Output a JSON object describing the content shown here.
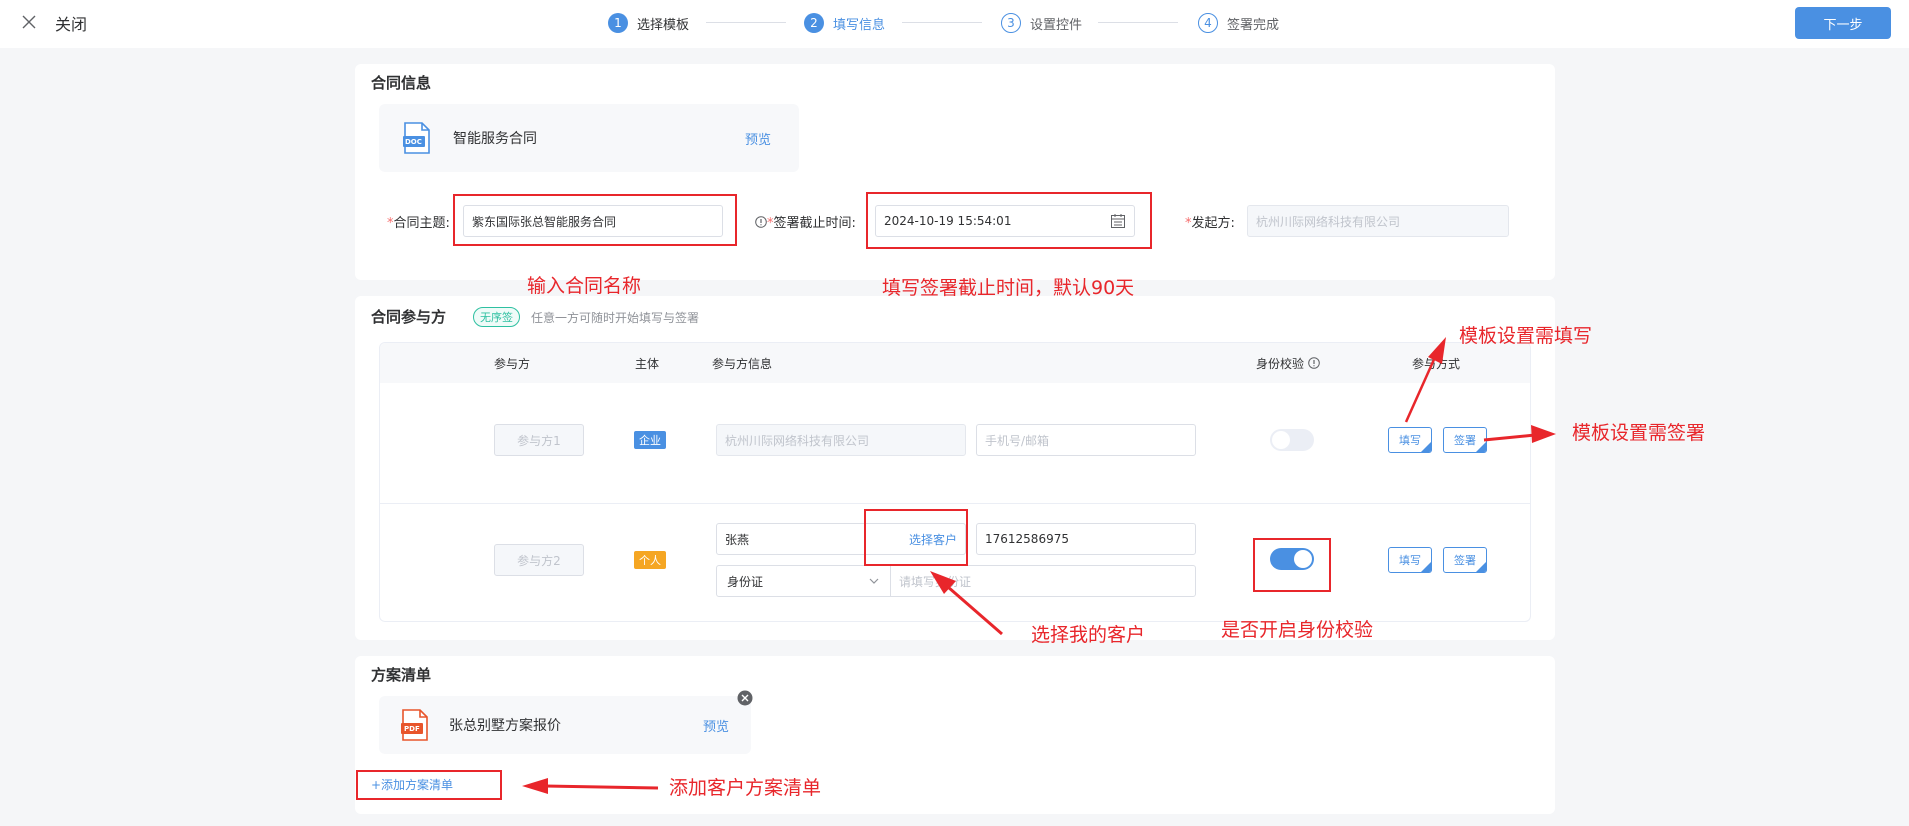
{
  "header": {
    "close_label": "关闭",
    "steps": [
      {
        "num": "1",
        "label": "选择模板",
        "state": "done"
      },
      {
        "num": "2",
        "label": "填写信息",
        "state": "active"
      },
      {
        "num": "3",
        "label": "设置控件",
        "state": "todo"
      },
      {
        "num": "4",
        "label": "签署完成",
        "state": "todo"
      }
    ],
    "next_label": "下一步"
  },
  "contract_info": {
    "title": "合同信息",
    "file": {
      "icon": "doc-file-icon",
      "icon_text": "DOC",
      "name": "智能服务合同",
      "preview": "预览"
    },
    "subject_label": "合同主题:",
    "subject_value": "紫东国际张总智能服务合同",
    "deadline_label": "签署截止时间:",
    "deadline_value": "2024-10-19 15:54:01",
    "initiator_label": "发起方:",
    "initiator_value": "杭州川际网络科技有限公司"
  },
  "parties": {
    "title": "合同参与方",
    "badge": "无序签",
    "hint": "任意一方可随时开始填写与签署",
    "columns": [
      "参与方",
      "主体",
      "参与方信息",
      "身份校验",
      "参与方式"
    ],
    "rows": [
      {
        "name": "参与方1",
        "entity": "企业",
        "entity_color": "#4a90e2",
        "org": "杭州川际网络科技有限公司",
        "contact_placeholder": "手机号/邮箱",
        "id_check": false,
        "fill_label": "填写",
        "sign_label": "签署"
      },
      {
        "name": "参与方2",
        "entity": "个人",
        "entity_color": "#f5a623",
        "person": "张燕",
        "select_customer": "选择客户",
        "phone": "17612586975",
        "id_type": "身份证",
        "id_placeholder": "请填写身份证",
        "id_check": true,
        "fill_label": "填写",
        "sign_label": "签署"
      }
    ]
  },
  "plan": {
    "title": "方案清单",
    "file": {
      "icon": "pdf-file-icon",
      "icon_text": "PDF",
      "name": "张总别墅方案报价",
      "preview": "预览"
    },
    "add_label": "+添加方案清单"
  },
  "annotations": {
    "subject": "输入合同名称",
    "deadline": "填写签署截止时间，默认90天",
    "fill": "模板设置需填写",
    "sign": "模板设置需签署",
    "customer": "选择我的客户",
    "id_check": "是否开启身份校验",
    "plan": "添加客户方案清单"
  },
  "colors": {
    "primary": "#4a90e2",
    "annotation": "#e8262b"
  }
}
